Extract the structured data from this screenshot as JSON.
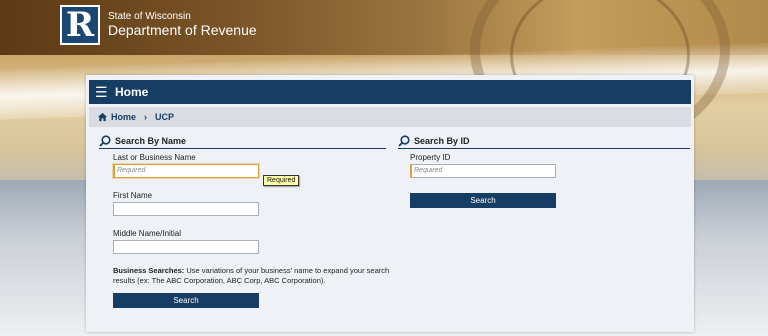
{
  "header": {
    "logo_letter": "R",
    "state": "State of Wisconsin",
    "department": "Department of Revenue"
  },
  "panel": {
    "title": "Home",
    "breadcrumb": [
      "Home",
      "UCP"
    ]
  },
  "search_by_name": {
    "heading": "Search By Name",
    "last_name_label": "Last or Business Name",
    "last_name_placeholder": "Required",
    "tooltip": "Required",
    "first_name_label": "First Name",
    "middle_name_label": "Middle Name/Initial",
    "note_bold": "Business Searches:",
    "note_text": " Use variations of your business' name to expand your search results (ex: The ABC Corporation, ABC Corp, ABC Corporation).",
    "search_button": "Search"
  },
  "search_by_id": {
    "heading": "Search By ID",
    "property_id_label": "Property ID",
    "property_id_placeholder": "Required",
    "search_button": "Search"
  },
  "colors": {
    "navy": "#163d63",
    "required_accent": "#e0a030",
    "tooltip_bg": "#ffffa8"
  }
}
